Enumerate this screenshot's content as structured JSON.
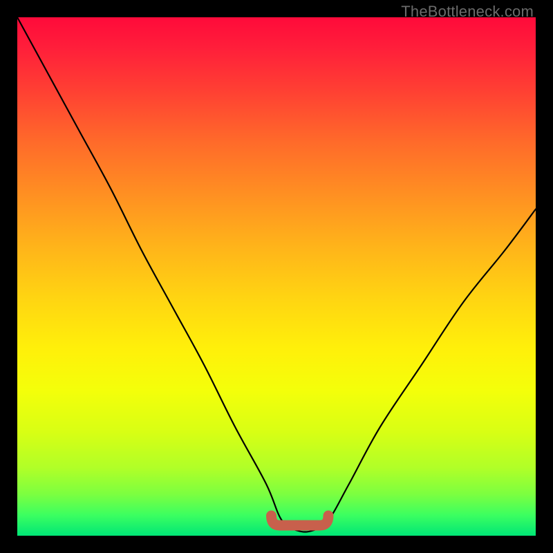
{
  "watermark": "TheBottleneck.com",
  "colors": {
    "curve_stroke": "#000000",
    "valley_marker": "#c8604c",
    "background": "#000000"
  },
  "chart_data": {
    "type": "line",
    "title": "",
    "xlabel": "",
    "ylabel": "",
    "xlim": [
      0,
      100
    ],
    "ylim": [
      0,
      100
    ],
    "series": [
      {
        "name": "bottleneck-curve",
        "x": [
          0,
          6,
          12,
          18,
          24,
          30,
          36,
          42,
          48,
          51,
          54,
          57,
          60,
          64,
          70,
          78,
          86,
          94,
          100
        ],
        "values": [
          100,
          89,
          78,
          67,
          55,
          44,
          33,
          21,
          10,
          3,
          1,
          1,
          3,
          10,
          21,
          33,
          45,
          55,
          63
        ]
      }
    ],
    "annotations": [
      {
        "name": "valley-marker",
        "x_range": [
          49,
          60
        ],
        "y": 2
      }
    ]
  }
}
